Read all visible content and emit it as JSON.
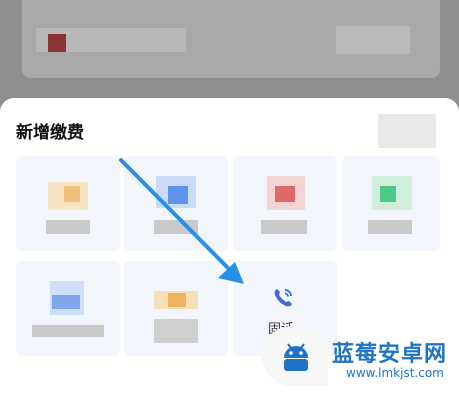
{
  "sheet": {
    "title": "新增缴费"
  },
  "tiles": [
    {
      "name": "tile-1",
      "label": ""
    },
    {
      "name": "tile-2",
      "label": ""
    },
    {
      "name": "tile-3",
      "label": ""
    },
    {
      "name": "tile-4",
      "label": ""
    },
    {
      "name": "tile-5",
      "label": ""
    },
    {
      "name": "tile-6",
      "label": ""
    },
    {
      "name": "tile-call",
      "label": "固话",
      "icon": "phone-icon"
    }
  ],
  "annotation": {
    "arrow_color": "#2a8fe8"
  },
  "watermark": {
    "title": "蓝莓安卓网",
    "url": "www.lmkjst.com"
  },
  "colors": {
    "accent": "#2a8fe8",
    "call_icon": "#3b6fd6"
  }
}
